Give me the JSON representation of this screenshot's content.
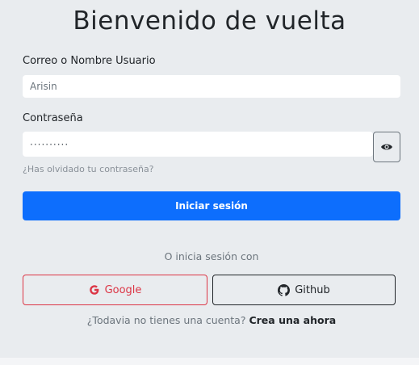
{
  "heading": "Bienvenido de vuelta",
  "form": {
    "username_label": "Correo o Nombre Usuario",
    "username_value": "Arisin",
    "password_label": "Contraseña",
    "password_value": "··········",
    "forgot_link": "¿Has olvidado tu contraseña?",
    "submit_label": "Iniciar sesión"
  },
  "social": {
    "divider_text": "O inicia sesión con",
    "google_label": "Google",
    "github_label": "Github"
  },
  "signup": {
    "question": "¿Todavia no tienes una cuenta?",
    "link": "Crea una ahora"
  },
  "colors": {
    "background": "#e9ecef",
    "primary": "#0d6efd",
    "google": "#dc3545",
    "github": "#212529"
  },
  "icons": [
    "eye-icon",
    "google-icon",
    "github-icon"
  ]
}
